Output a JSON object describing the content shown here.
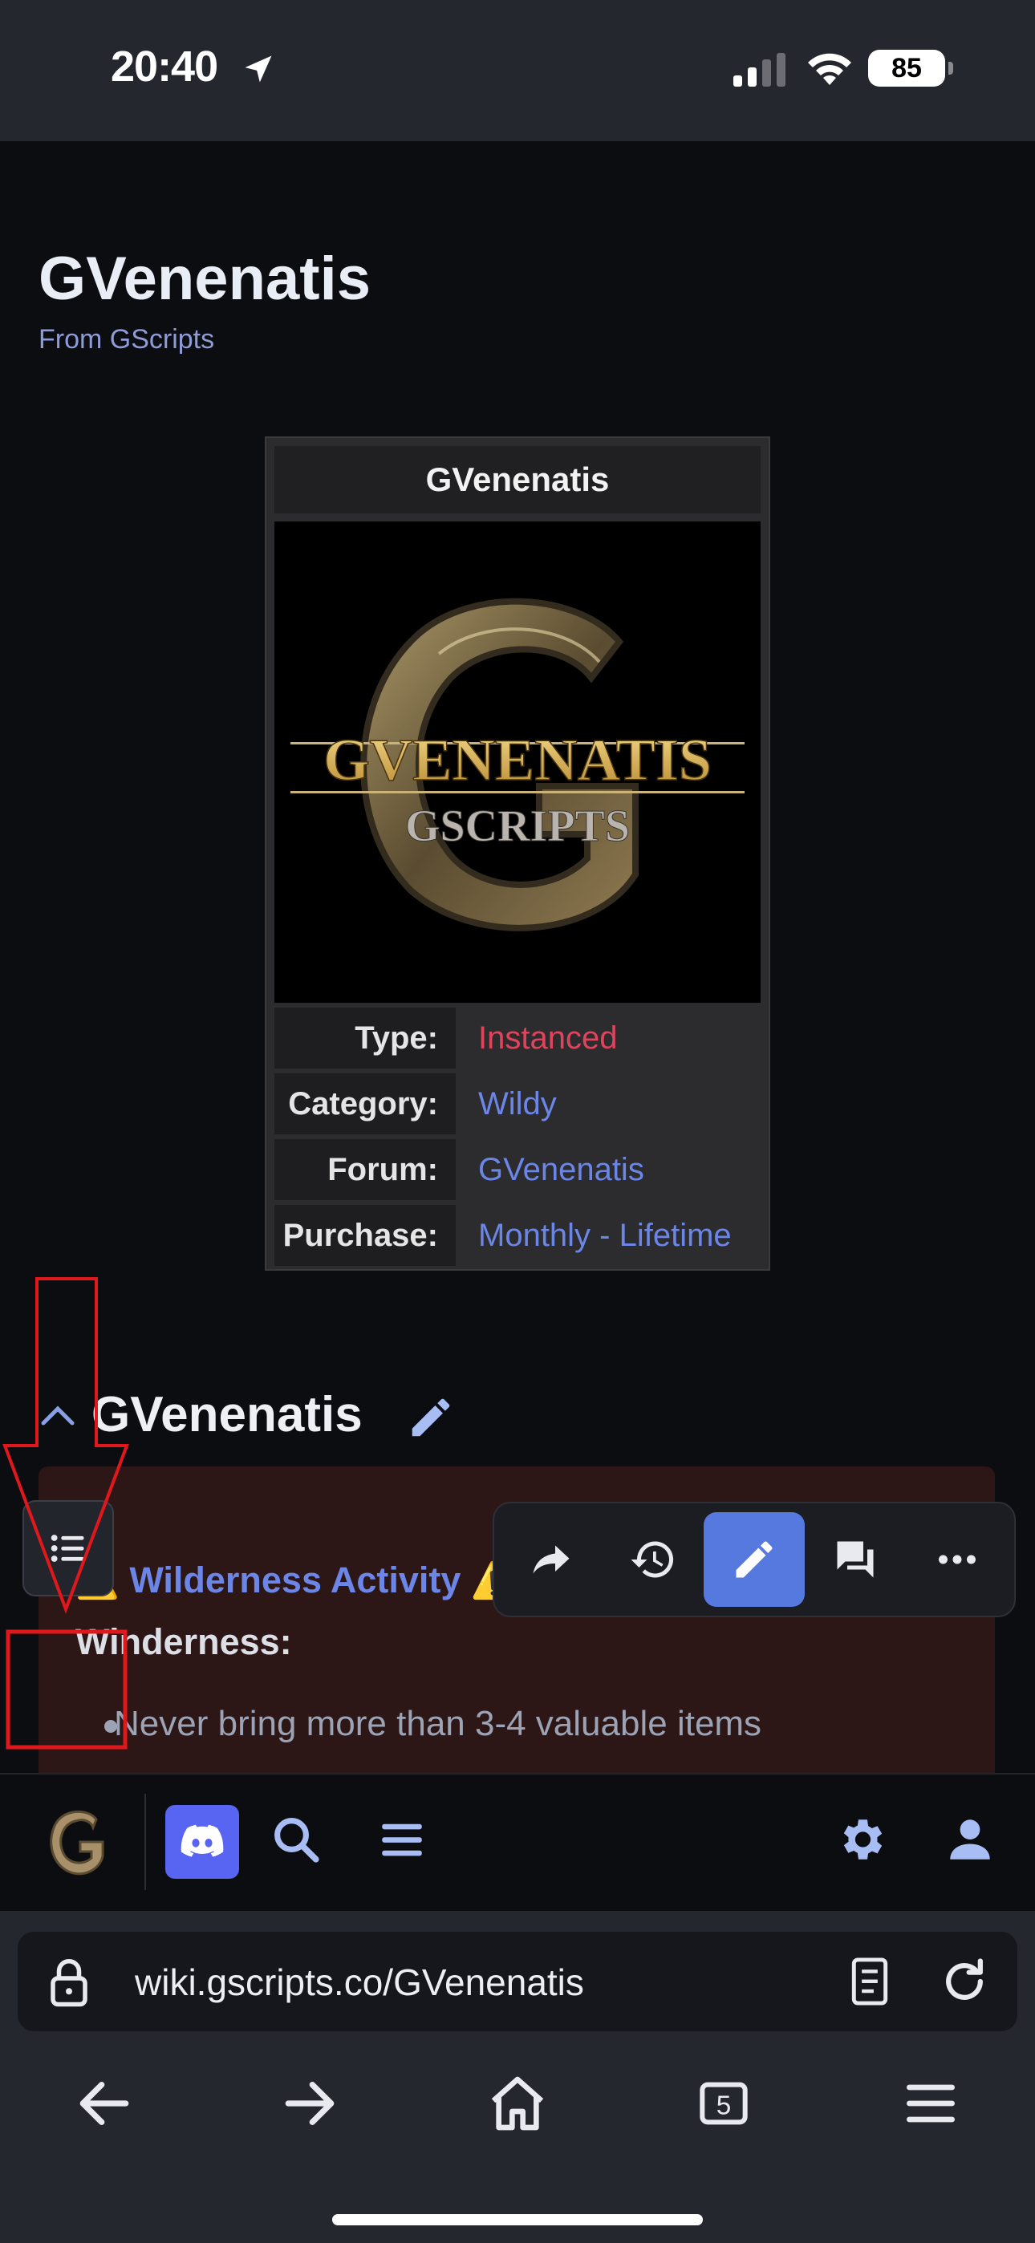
{
  "status_bar": {
    "time": "20:40",
    "battery": "85"
  },
  "page": {
    "title": "GVenenatis",
    "subtitle": "From GScripts",
    "infobox": {
      "title": "GVenenatis",
      "logo_text": "GVENENATIS",
      "logo_subtext": "GSCRIPTS",
      "rows": [
        {
          "key": "Type:",
          "value": "Instanced"
        },
        {
          "key": "Category:",
          "value": "Wildy"
        },
        {
          "key": "Forum:",
          "value": "GVenenatis"
        },
        {
          "key": "Purchase:",
          "value": "Monthly - Lifetime"
        }
      ]
    },
    "section": {
      "title": "GVenenatis",
      "warning_emoji": "⚠️",
      "warning_link": "Wilderness Activity",
      "warning_text": "This script operates in the Winderness:",
      "bullet": "Never bring more than 3-4 valuable items"
    }
  },
  "float_toolbar": [
    "share-icon",
    "history-icon",
    "edit-icon",
    "talk-icon",
    "more-icon"
  ],
  "site_nav": [
    "site-logo",
    "discord-icon",
    "search-icon",
    "menu-icon",
    "settings-icon",
    "user-icon"
  ],
  "browser": {
    "url": "wiki.gscripts.co/GVenenatis",
    "tab_count": "5"
  },
  "colors": {
    "accent": "#5679e0",
    "link": "#6b86e6",
    "instanced": "#e0445c",
    "warning_bg": "#2d1616",
    "annotation": "#e0181c"
  }
}
